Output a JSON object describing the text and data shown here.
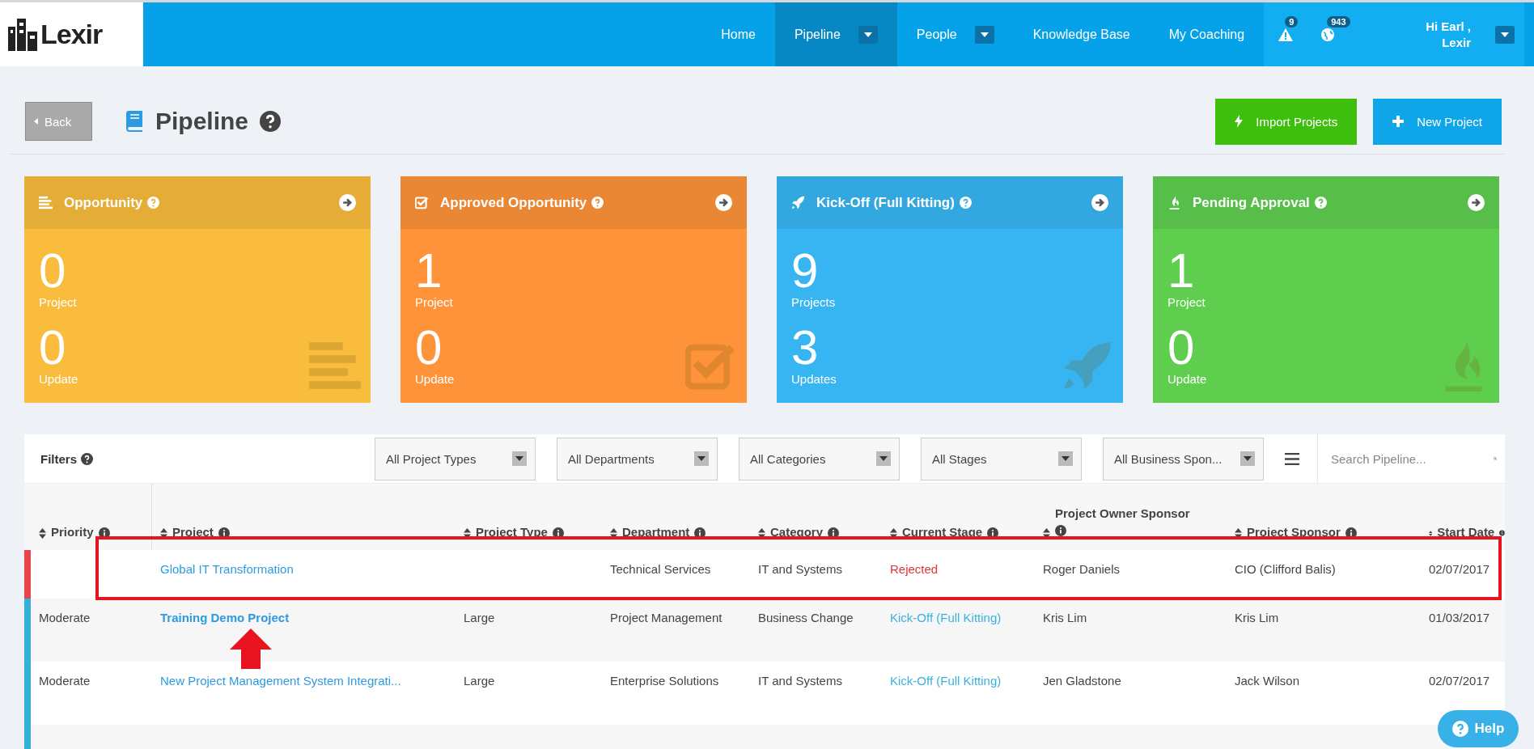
{
  "logo": {
    "text": "Lexir"
  },
  "nav": {
    "items": [
      {
        "label": "Home",
        "selected": false,
        "dropdown": false
      },
      {
        "label": "Pipeline",
        "selected": true,
        "dropdown": true
      },
      {
        "label": "People",
        "selected": false,
        "dropdown": true
      },
      {
        "label": "Knowledge Base",
        "selected": false,
        "dropdown": false
      },
      {
        "label": "My Coaching",
        "selected": false,
        "dropdown": false
      }
    ],
    "alerts": [
      {
        "kind": "warning",
        "count": "9"
      },
      {
        "kind": "globe",
        "count": "943"
      }
    ],
    "user": {
      "greeting": "Hi Earl ,",
      "org": "Lexir"
    }
  },
  "page_header": {
    "back": "Back",
    "title": "Pipeline",
    "actions": [
      {
        "kind": "import",
        "label": "Import Projects"
      },
      {
        "kind": "new",
        "label": "New Project"
      }
    ]
  },
  "cards": [
    {
      "kind": "opportunity",
      "title": "Opportunity",
      "color": "#f9bc3d",
      "projects": "0",
      "projects_label": "Project",
      "updates": "0",
      "updates_label": "Update"
    },
    {
      "kind": "approved",
      "title": "Approved Opportunity",
      "color": "#fe9339",
      "projects": "1",
      "projects_label": "Project",
      "updates": "0",
      "updates_label": "Update"
    },
    {
      "kind": "kickoff",
      "title": "Kick-Off (Full Kitting)",
      "color": "#37b5f2",
      "projects": "9",
      "projects_label": "Projects",
      "updates": "3",
      "updates_label": "Updates"
    },
    {
      "kind": "pending",
      "title": "Pending Approval",
      "color": "#5fce4f",
      "projects": "1",
      "projects_label": "Project",
      "updates": "0",
      "updates_label": "Update"
    }
  ],
  "filters": {
    "label": "Filters",
    "dropdowns": [
      "All Project Types",
      "All Departments",
      "All Categories",
      "All Stages",
      "All Business Spon..."
    ],
    "search": {
      "placeholder": "Search Pipeline..."
    }
  },
  "table": {
    "columns": [
      "Priority",
      "Project",
      "Project Type",
      "Department",
      "Category",
      "Current Stage",
      "Project Owner Sponsor",
      "Project Sponsor",
      "Start Date"
    ],
    "rows": [
      {
        "color": "#e8424a",
        "bold": false,
        "cells": [
          "",
          "Global IT Transformation",
          "",
          "Technical Services",
          "IT and Systems",
          "",
          "Roger Daniels",
          "CIO (Clifford Balis)",
          "02/07/2017"
        ],
        "stage": {
          "text": "Rejected",
          "kind": "rejected"
        }
      },
      {
        "color": "#35b0d8",
        "bold": true,
        "cells": [
          "Moderate",
          "Training Demo Project",
          "Large",
          "Project Management",
          "Business Change",
          "",
          "Kris Lim",
          "Kris Lim",
          "01/03/2017"
        ],
        "stage": {
          "text": "Kick-Off (Full Kitting)",
          "kind": "active"
        }
      },
      {
        "color": "#35b0d8",
        "bold": false,
        "cells": [
          "Moderate",
          "New Project Management System Integrati...",
          "Large",
          "Enterprise Solutions",
          "IT and Systems",
          "",
          "Jen Gladstone",
          "Jack Wilson",
          "02/07/2017"
        ],
        "stage": {
          "text": "Kick-Off (Full Kitting)",
          "kind": "active"
        }
      }
    ]
  },
  "help": {
    "label": "Help"
  }
}
